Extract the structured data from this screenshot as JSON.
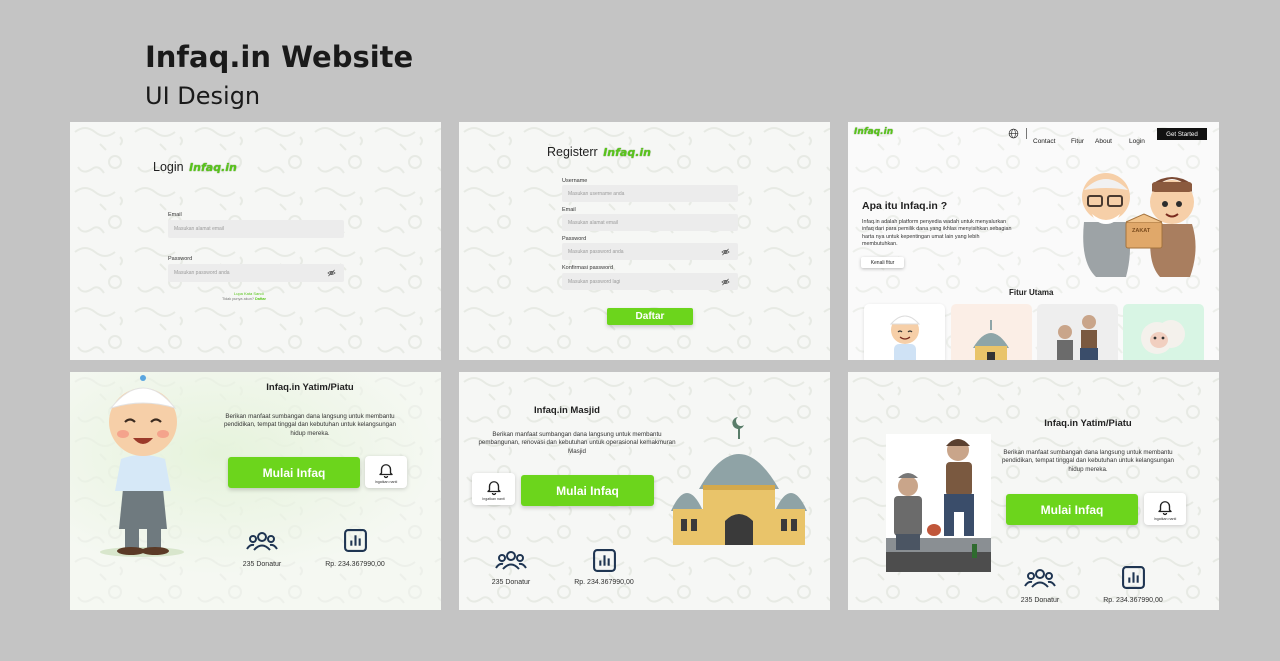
{
  "header": {
    "title": "Infaq.in Website",
    "subtitle": "UI Design"
  },
  "brand": {
    "logo": "Infaq.in",
    "accent": "#6cd51c"
  },
  "login": {
    "title": "Login",
    "email_label": "Email",
    "email_placeholder": "Masukan alamat email",
    "password_label": "Password",
    "password_placeholder": "Masukan password anda",
    "forgot": "Lupa Kata Sandi",
    "no_account": "Tidak punya akun?",
    "register_link": "Daftar"
  },
  "register": {
    "title": "Registerr",
    "username_label": "Username",
    "username_placeholder": "Masukan username anda",
    "email_label": "Email",
    "email_placeholder": "Masukan alamat email",
    "password_label": "Password",
    "password_placeholder": "Masukan password anda",
    "confirm_label": "Konfirmasi password",
    "confirm_placeholder": "Masukan password lagi",
    "submit": "Daftar"
  },
  "landing": {
    "nav": {
      "contact": "Contact",
      "fitur": "Fitur",
      "about": "About",
      "login": "Login",
      "cta": "Get Started"
    },
    "hero_title": "Apa itu Infaq.in ?",
    "hero_desc": "Infaq.in adalah platform penyedia wadah untuk menyalurkan infaq dari para pemilik dana yang ikhlas menyisihkan sebagian harta nya untuk kepentingan umat lain yang lebih membutuhkan.",
    "hero_button": "Kenali fitur",
    "zakat_label": "ZAKAT",
    "features_title": "Fitur Utama"
  },
  "yatim": {
    "title": "Infaq.in Yatim/Piatu",
    "desc": "Berikan manfaat sumbangan dana langsung untuk membantu pendidikan, tempat tinggal dan kebutuhan untuk kelangsungan hidup mereka.",
    "button": "Mulai Infaq",
    "notify": "Ingatkan nanti",
    "donors": "235 Donatur",
    "amount": "Rp. 234.367990,00"
  },
  "masjid": {
    "title": "Infaq.in Masjid",
    "desc": "Berikan manfaat sumbangan dana langsung untuk membantu pembangunan, renovasi dan kebutuhan untuk operasional kemakmuran Masjid",
    "button": "Mulai Infaq",
    "notify": "Ingatkan nanti",
    "donors": "235 Donatur",
    "amount": "Rp. 234.367990,00"
  },
  "dhuafa": {
    "title": "Infaq.in Yatim/Piatu",
    "desc": "Berikan manfaat sumbangan dana langsung untuk membantu pendidikan, tempat tinggal dan kebutuhan untuk kelangsungan hidup mereka.",
    "button": "Mulai Infaq",
    "notify": "Ingatkan nanti",
    "donors": "235 Donatur",
    "amount": "Rp. 234.367990,00"
  }
}
